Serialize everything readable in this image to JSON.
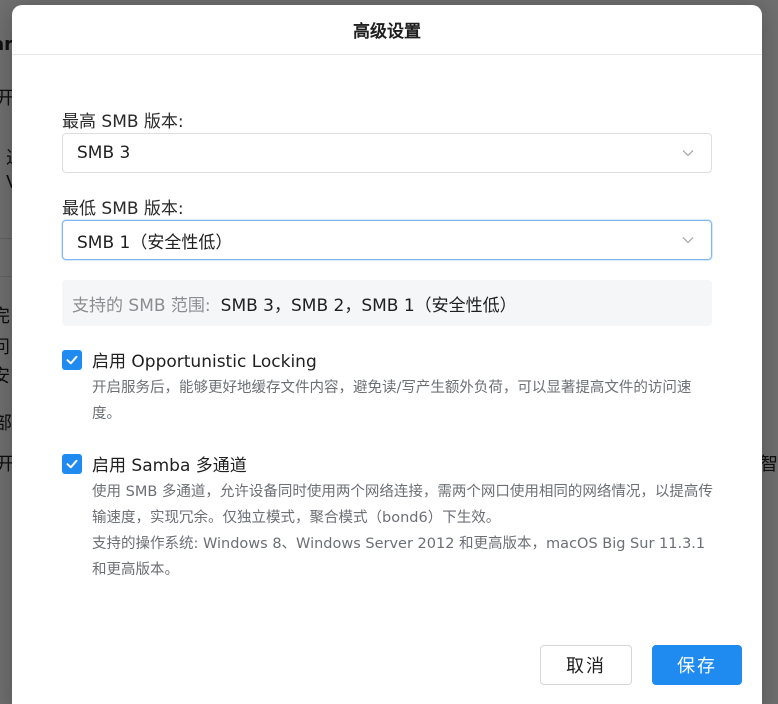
{
  "background": {
    "fragments": [
      "ar",
      "开启",
      "过",
      "V",
      "完",
      "问",
      "安",
      "部",
      "开启",
      "智"
    ]
  },
  "dialog": {
    "title": "高级设置",
    "max_version": {
      "label": "最高 SMB 版本:",
      "value": "SMB 3"
    },
    "min_version": {
      "label": "最低 SMB 版本:",
      "value": "SMB 1（安全性低）"
    },
    "range": {
      "label": "支持的 SMB 范围:",
      "value": "SMB 3，SMB 2，SMB 1（安全性低）"
    },
    "options": [
      {
        "label": "启用 Opportunistic Locking",
        "checked": true,
        "desc": [
          "开启服务后，能够更好地缓存文件内容，避免读/写产生额外负荷，可以显著提高文件的访问速度。"
        ]
      },
      {
        "label": "启用 Samba 多通道",
        "checked": true,
        "desc": [
          "使用 SMB 多通道，允许设备同时使用两个网络连接，需两个网口使用相同的网络情况，以提高传输速度，实现冗余。仅独立模式，聚合模式（bond6）下生效。",
          "支持的操作系统: Windows 8、Windows Server 2012 和更高版本，macOS Big Sur 11.3.1 和更高版本。"
        ]
      }
    ],
    "buttons": {
      "cancel": "取消",
      "save": "保存"
    }
  },
  "colors": {
    "accent": "#1f8bf0",
    "focus_border": "#7fb6ee"
  }
}
